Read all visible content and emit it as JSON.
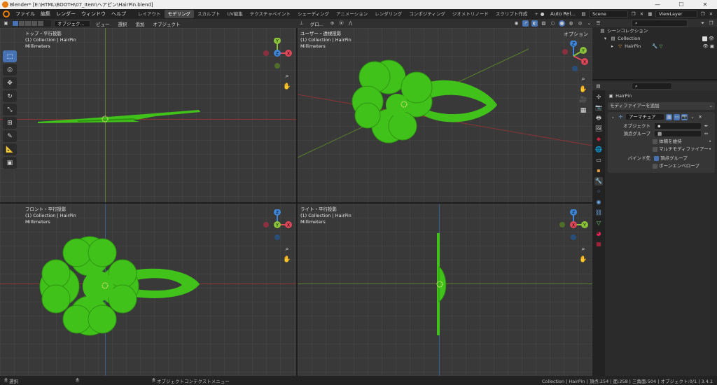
{
  "window": {
    "title": "Blender* [E:\\HTML\\BOOTH\\07_Item\\ヘアピン\\HairPin.blend]",
    "minimize": "—",
    "maximize": "☐",
    "close": "✕"
  },
  "menu": {
    "items": [
      "ファイル",
      "編集",
      "レンダー",
      "ウィンドウ",
      "ヘルプ"
    ],
    "workspaces": [
      "レイアウト",
      "モデリング",
      "スカルプト",
      "UV編集",
      "テクスチャペイント",
      "シェーディング",
      "アニメーション",
      "レンダリング",
      "コンポジティング",
      "ジオメトリノード",
      "スクリプト作成"
    ],
    "add_tab": "+",
    "pin": "Auto Rel...",
    "scene": "Scene",
    "viewlayer": "ViewLayer"
  },
  "viewport_header": {
    "mode": "オブジェク...",
    "menus": [
      "ビュー",
      "選択",
      "追加",
      "オブジェクト"
    ],
    "transform": "グロ...",
    "options": "オプション"
  },
  "viewports": [
    {
      "id": "top",
      "line1": "トップ・平行投影",
      "line2": "(1) Collection | HairPin",
      "line3": "Millimeters"
    },
    {
      "id": "user",
      "line1": "ユーザー・透視投影",
      "line2": "(1) Collection | HairPin",
      "line3": "Millimeters"
    },
    {
      "id": "front",
      "line1": "フロント・平行投影",
      "line2": "(1) Collection | HairPin",
      "line3": "Millimeters"
    },
    {
      "id": "right",
      "line1": "ライト・平行投影",
      "line2": "(1) Collection | HairPin",
      "line3": "Millimeters"
    }
  ],
  "gizmo": {
    "x": "X",
    "y": "Y",
    "z": "Z"
  },
  "outliner": {
    "scene_collection": "シーンコレクション",
    "collection": "Collection",
    "object": "HairPin"
  },
  "properties": {
    "object_name": "HairPin",
    "add_modifier": "モディファイアーを追加",
    "modifier_name": "アーマチュア",
    "object_label": "オブジェクト",
    "vertex_group_label": "頂点グループ",
    "preserve_volume": "体積を維持",
    "multi_modifier": "マルチモディファイアー",
    "bind_to": "バインド先",
    "bind_vertex_groups": "頂点グループ",
    "bind_envelopes": "ボーンエンベロープ"
  },
  "status": {
    "select": "選択",
    "context_menu": "オブジェクトコンテクストメニュー",
    "stats": "Collection | HairPin | 頂点:254 | 面:258 | 三角面:504 | オブジェクト:0/1 | 3.4.1"
  },
  "colors": {
    "clover": "#41c21a",
    "clover_dark": "#2e9612",
    "x_axis": "#e0485a",
    "y_axis": "#8bc33a",
    "z_axis": "#3f86d8",
    "accent": "#4772b3"
  }
}
